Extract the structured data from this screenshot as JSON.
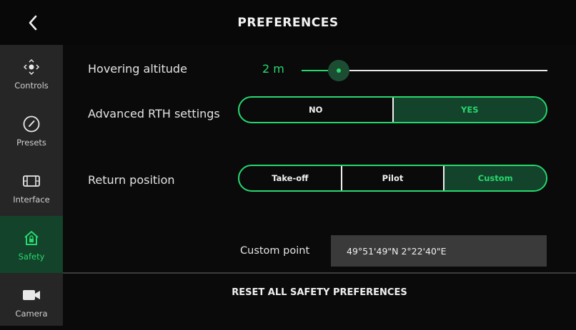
{
  "header": {
    "title": "PREFERENCES",
    "back_icon": "chevron-left-icon"
  },
  "sidebar": {
    "items": [
      {
        "label": "Controls",
        "icon": "joystick-icon",
        "active": false
      },
      {
        "label": "Presets",
        "icon": "gauge-icon",
        "active": false
      },
      {
        "label": "Interface",
        "icon": "film-frame-icon",
        "active": false
      },
      {
        "label": "Safety",
        "icon": "home-lock-icon",
        "active": true
      },
      {
        "label": "Camera",
        "icon": "video-camera-icon",
        "active": false
      }
    ]
  },
  "settings": {
    "hovering_altitude": {
      "label": "Hovering altitude",
      "value": "2 m",
      "slider_fraction": 0.15
    },
    "advanced_rth": {
      "label": "Advanced RTH settings",
      "options": [
        "NO",
        "YES"
      ],
      "selected": "YES"
    },
    "return_position": {
      "label": "Return position",
      "options": [
        "Take-off",
        "Pilot",
        "Custom"
      ],
      "selected": "Custom"
    },
    "custom_point": {
      "label": "Custom point",
      "value": "49°51'49\"N 2°22'40\"E"
    }
  },
  "reset": {
    "label": "RESET ALL SAFETY PREFERENCES"
  },
  "colors": {
    "accent": "#27d86f",
    "active_bg": "#13432a",
    "sidebar_bg": "#262626",
    "background": "#0a0a0a"
  }
}
